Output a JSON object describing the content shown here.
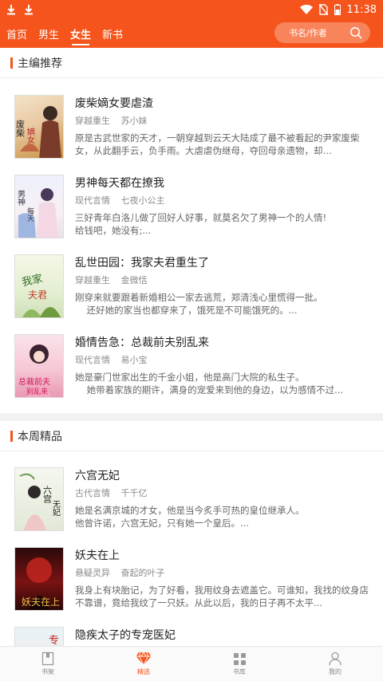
{
  "statusbar": {
    "time": "11:38",
    "icons": [
      "download-icon",
      "download-icon",
      "wifi-icon",
      "no-sim-icon",
      "battery-icon"
    ]
  },
  "nav": {
    "tabs": [
      {
        "label": "首页",
        "active": false
      },
      {
        "label": "男生",
        "active": false
      },
      {
        "label": "女生",
        "active": true
      },
      {
        "label": "新书",
        "active": false
      }
    ],
    "search_placeholder": "书名/作者"
  },
  "sections": [
    {
      "title": "主编推荐",
      "books": [
        {
          "title": "废柴嫡女要虐渣",
          "category": "穿越重生",
          "author": "苏小妹",
          "desc": [
            "原是古武世家的天才，一朝穿越到云天大陆成了最不被看起的尹家废柴女，从此翻手云，负手雨。大虐虐伪继母，夺回母亲遗物，却…"
          ],
          "cover_title": "废柴嫡女要虐渣"
        },
        {
          "title": "男神每天都在撩我",
          "category": "现代言情",
          "author": "七夜小公主",
          "desc": [
            "三好青年白洛儿做了回好人好事，就莫名欠了男神一个的人情!",
            "给钱吧，她没有;..."
          ],
          "cover_title": "男神每天都在撩我"
        },
        {
          "title": "乱世田园：我家夫君重生了",
          "category": "穿越重生",
          "author": "金微恬",
          "desc": [
            "刚穿来就要跟着新婚相公一家去逃荒，郑清浅心里慌得一批。",
            "    还好她的家当也都穿来了，饿死是不可能饿死的。..."
          ],
          "cover_title": "我家夫君重生了"
        },
        {
          "title": "婚情告急：总裁前夫别乱来",
          "category": "现代言情",
          "author": "易小宝",
          "desc": [
            "她是豪门世家出生的千金小姐，他是高门大院的私生子。",
            "    她带着家族的期许，满身的宠爱来到他的身边，以为感情不过..."
          ],
          "cover_title": "总裁前夫别乱来"
        }
      ]
    },
    {
      "title": "本周精品",
      "books": [
        {
          "title": "六宫无妃",
          "category": "古代言情",
          "author": "千千亿",
          "desc": [
            "她是名满京城的才女，他是当今炙手可热的皇位继承人。",
            "他曾许诺，六宫无妃，只有她一个皇后。..."
          ],
          "cover_title": "六宫无妃"
        },
        {
          "title": "妖夫在上",
          "category": "悬疑灵异",
          "author": "奋起的叶子",
          "desc": [
            "我身上有块胎记，为了好看，我用纹身去遮盖它。可谁知，我找的纹身店不靠谱，竟给我纹了一只妖。从此以后，我的日子再不太平..."
          ],
          "cover_title": "妖夫在上"
        },
        {
          "title": "隐疾太子的专宠医妃",
          "category": "",
          "author": "",
          "desc": [],
          "cover_title": ""
        }
      ]
    }
  ],
  "bottom_tabs": [
    {
      "label": "书架",
      "icon": "bookshelf-icon",
      "active": false
    },
    {
      "label": "精选",
      "icon": "diamond-icon",
      "active": true
    },
    {
      "label": "书库",
      "icon": "grid-icon",
      "active": false
    },
    {
      "label": "我的",
      "icon": "user-icon",
      "active": false
    }
  ],
  "colors": {
    "accent": "#f5551c"
  }
}
